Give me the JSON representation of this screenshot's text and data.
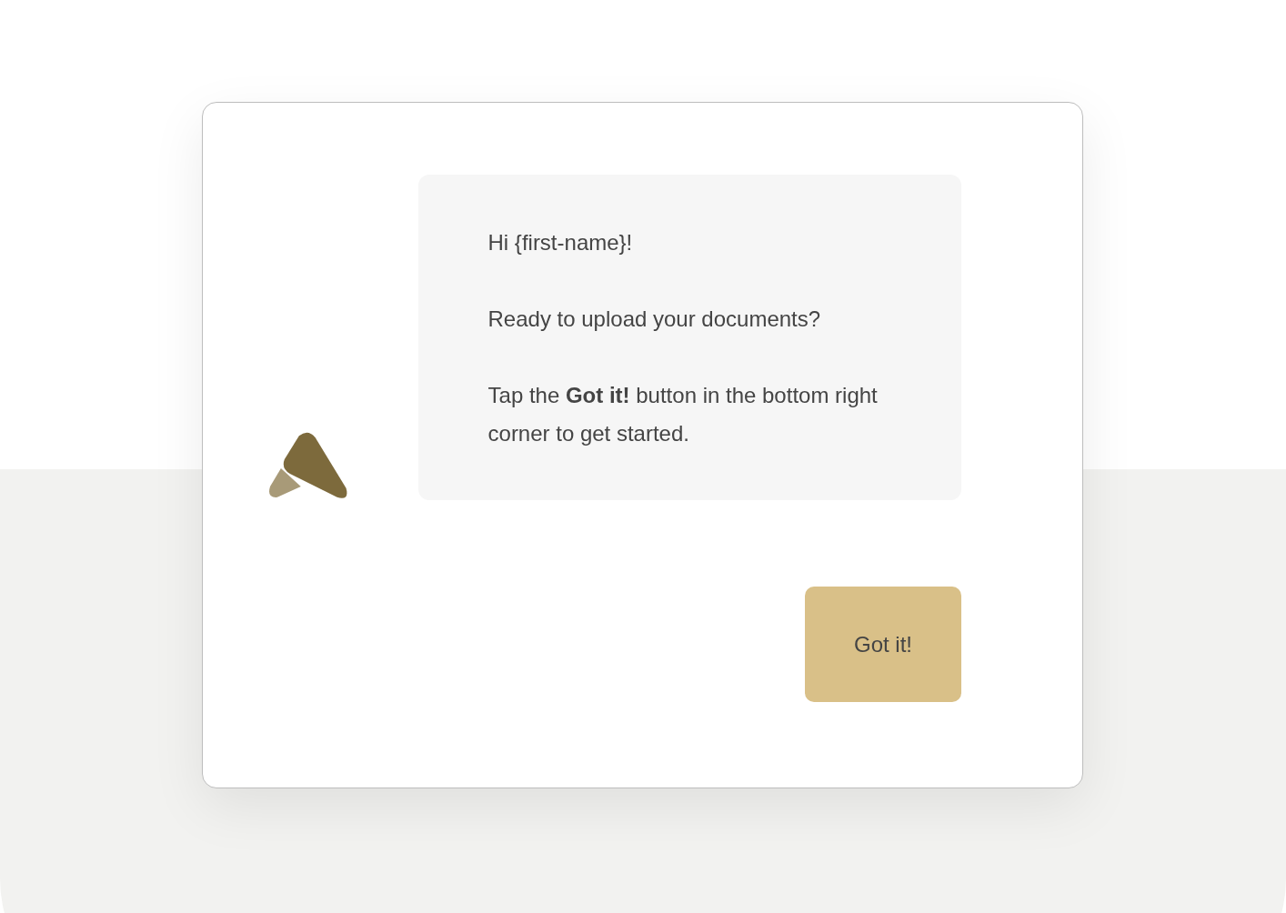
{
  "message": {
    "paragraphs": [
      "Hi {first-name}!",
      "Ready to upload your documents?",
      "Tap the **Got it!** button in the bottom right corner to get started."
    ]
  },
  "button": {
    "label": "Got it!"
  }
}
